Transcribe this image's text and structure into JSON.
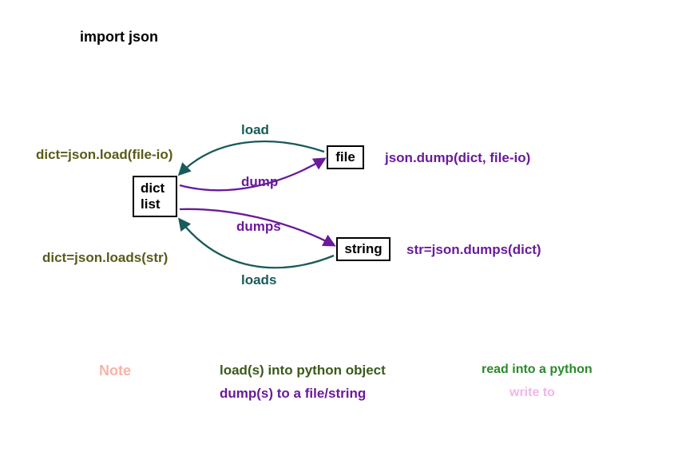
{
  "header": {
    "title": "import json"
  },
  "boxes": {
    "source": {
      "line1": "dict",
      "line2": "list"
    },
    "file": "file",
    "string": "string"
  },
  "arrows": {
    "load": "load",
    "dump": "dump",
    "dumps": "dumps",
    "loads": "loads"
  },
  "code": {
    "load_example": "dict=json.load(file-io)",
    "dump_example": "json.dump(dict, file-io)",
    "loads_example": "dict=json.loads(str)",
    "dumps_example": "str=json.dumps(dict)"
  },
  "notes": {
    "label": "Note",
    "load_desc": "load(s) into python object",
    "dump_desc": "dump(s) to a file/string",
    "read_desc": "read into a python",
    "write_desc": "write to"
  },
  "colors": {
    "teal": "#1a5a5a",
    "purple": "#6a1a9a",
    "olive": "#5a5a1a",
    "pink": "#f7b4a7",
    "green": "#2a8a2a",
    "light_pink": "#f2b6e8"
  }
}
